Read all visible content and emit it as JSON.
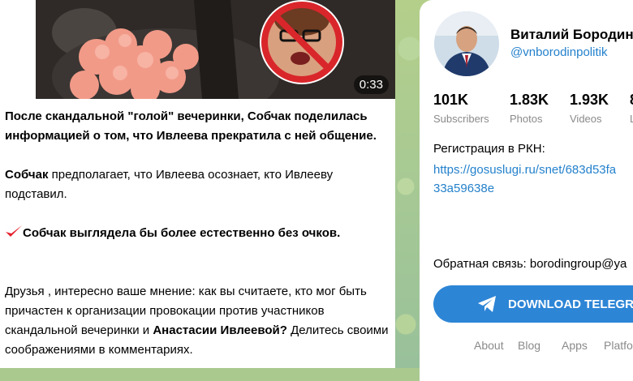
{
  "post": {
    "video": {
      "duration": "0:33"
    },
    "paragraph1": "После скандальной \"голой\" вечеринки, Собчак поделилась информацией о том, что Ивлеева прекратила с ней общение.",
    "paragraph2_bold": "Собчак",
    "paragraph2_rest": " предполагает, что Ивлеева осознает, кто Ивлееву подставил.",
    "paragraph3": "Собчак выглядела бы более естественно без очков.",
    "paragraph4_a": "Друзья , интересно ваше мнение: как вы считаете, кто мог быть причастен к организации провокации против участников скандальной вечеринки и ",
    "paragraph4_bold": "Анастасии Ивлеевой?",
    "paragraph4_b": " Делитесь своими соображениями в комментариях.",
    "check_color": "#e5202e"
  },
  "channel": {
    "name": "Виталий Бородин",
    "handle": "@vnborodinpolitik",
    "stats": [
      {
        "value": "101K",
        "label": "Subscribers"
      },
      {
        "value": "1.83K",
        "label": "Photos"
      },
      {
        "value": "1.93K",
        "label": "Videos"
      },
      {
        "value": "8",
        "label": "L"
      }
    ],
    "registration_label": "Регистрация в РКН:",
    "registration_link_line1": "https://gosuslugi.ru/snet/683d53fa",
    "registration_link_line2": "33a59638e",
    "feedback": "Обратная связь: borodingroup@ya",
    "download_button": "DOWNLOAD TELEGRA",
    "footer_links": [
      "About",
      "Blog",
      "Apps",
      "Platfo"
    ]
  },
  "colors": {
    "link": "#2481cc",
    "button": "#2d85d6",
    "background": "#a9c98f"
  }
}
